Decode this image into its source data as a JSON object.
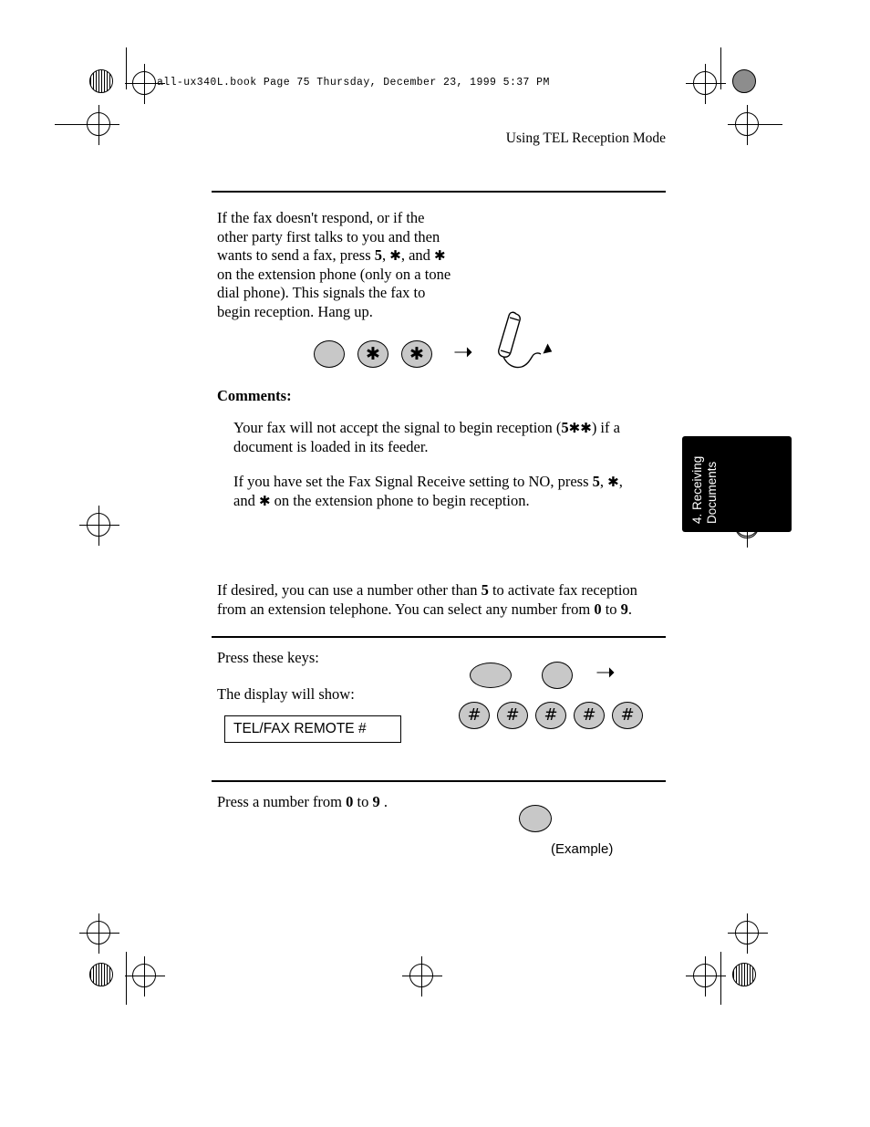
{
  "page": {
    "book_line": "all-ux340L.book  Page 75  Thursday, December 23, 1999  5:37 PM",
    "running_head": "Using TEL Reception Mode",
    "side_tab": "4. Receiving\nDocuments"
  },
  "content": {
    "intro_html": "If the fax doesn't respond, or if the other party first talks to you and then wants to send a fax, press <b>5</b>, <span class=\"istar\">&#10033;</span>, and <span class=\"istar\">&#10033;</span> on the extension phone (only on a tone dial phone). This signals the fax to begin reception. Hang up.",
    "comments_label": "Comments:",
    "comment1_html": "Your fax will not accept the signal to begin reception (<b>5</b><span class=\"istar\">&#10033;</span><span class=\"istar\">&#10033;</span>) if a document is loaded in its feeder.",
    "comment2_html": "If you have set the Fax Signal Receive setting to NO, press <b>5</b>, <span class=\"istar\">&#10033;</span>, and <span class=\"istar\">&#10033;</span> on the extension phone to begin reception.",
    "note_html": "If desired, you can use a number other than <b>5</b> to activate fax reception from an extension telephone. You can select any number from <b>0</b> to <b>9</b>.",
    "press_keys_label": "Press these keys:",
    "display_will_show_label": "The display will show:",
    "display_text": "TEL/FAX REMOTE #",
    "press_number_html": "Press a number from <b>0</b> to <b>9</b> .",
    "example_label": "(Example)"
  },
  "keys": {
    "step1": [
      {
        "name": "key-blank",
        "glyph": ""
      },
      {
        "name": "key-asterisk",
        "glyph": "✳"
      },
      {
        "name": "key-asterisk",
        "glyph": "✳"
      }
    ],
    "step2_top": [
      {
        "name": "key-function-oval",
        "glyph": ""
      },
      {
        "name": "key-blank-round",
        "glyph": ""
      }
    ],
    "step2_hash": [
      {
        "name": "key-hash",
        "glyph": "#"
      },
      {
        "name": "key-hash",
        "glyph": "#"
      },
      {
        "name": "key-hash",
        "glyph": "#"
      },
      {
        "name": "key-hash",
        "glyph": "#"
      },
      {
        "name": "key-hash",
        "glyph": "#"
      }
    ],
    "step3": [
      {
        "name": "key-number-blank",
        "glyph": ""
      }
    ],
    "arrow_glyph": "➜"
  },
  "colors": {
    "key_fill": "#c8c8c8",
    "tab_fill": "#000000",
    "page_bg": "#ffffff"
  }
}
